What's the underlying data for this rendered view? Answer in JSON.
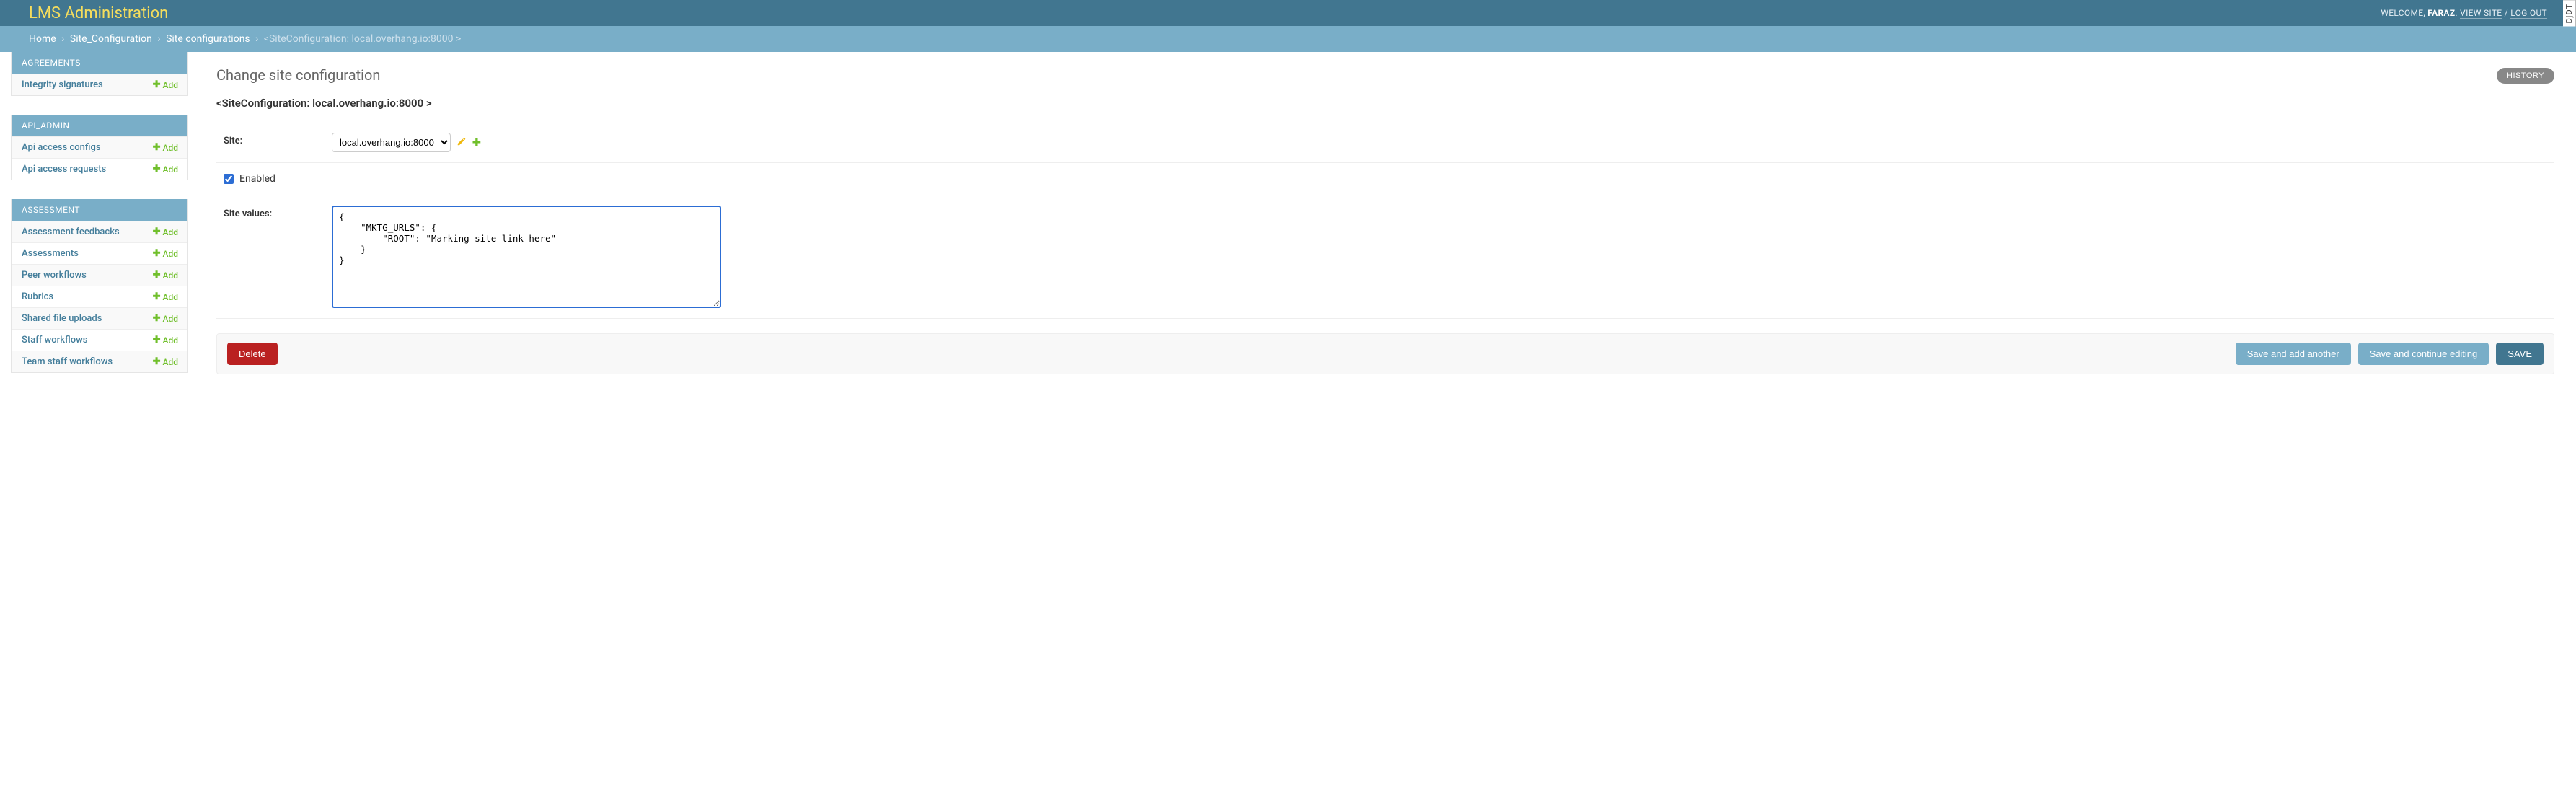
{
  "header": {
    "branding": "LMS Administration",
    "welcome_prefix": "WELCOME, ",
    "username": "FARAZ",
    "view_site": "VIEW SITE",
    "log_out": "LOG OUT",
    "separator": " / "
  },
  "breadcrumbs": {
    "home": "Home",
    "app": "Site_Configuration",
    "model": "Site configurations",
    "current": "<SiteConfiguration: local.overhang.io:8000 >"
  },
  "sidebar": [
    {
      "key": "agreements",
      "caption": "AGREEMENTS",
      "models": [
        {
          "key": "integrity-signatures",
          "name": "Integrity signatures",
          "add": "Add"
        }
      ]
    },
    {
      "key": "api-admin",
      "caption": "API_ADMIN",
      "models": [
        {
          "key": "api-access-configs",
          "name": "Api access configs",
          "add": "Add"
        },
        {
          "key": "api-access-requests",
          "name": "Api access requests",
          "add": "Add"
        }
      ]
    },
    {
      "key": "assessment",
      "caption": "ASSESSMENT",
      "models": [
        {
          "key": "assessment-feedbacks",
          "name": "Assessment feedbacks",
          "add": "Add"
        },
        {
          "key": "assessments",
          "name": "Assessments",
          "add": "Add"
        },
        {
          "key": "peer-workflows",
          "name": "Peer workflows",
          "add": "Add"
        },
        {
          "key": "rubrics",
          "name": "Rubrics",
          "add": "Add"
        },
        {
          "key": "shared-file-uploads",
          "name": "Shared file uploads",
          "add": "Add"
        },
        {
          "key": "staff-workflows",
          "name": "Staff workflows",
          "add": "Add"
        },
        {
          "key": "team-staff-workflows",
          "name": "Team staff workflows",
          "add": "Add"
        }
      ]
    }
  ],
  "main": {
    "title": "Change site configuration",
    "history_label": "HISTORY",
    "object_repr": "<SiteConfiguration: local.overhang.io:8000 >",
    "fields": {
      "site_label": "Site:",
      "site_options": [
        "local.overhang.io:8000"
      ],
      "site_selected": "local.overhang.io:8000",
      "enabled_label": "Enabled",
      "enabled_checked": true,
      "site_values_label": "Site values:",
      "site_values_text": "{\n    \"MKTG_URLS\": {\n        \"ROOT\": \"Marking site link here\"\n    }\n}"
    },
    "buttons": {
      "delete": "Delete",
      "save_add_another": "Save and add another",
      "save_continue": "Save and continue editing",
      "save": "SAVE"
    }
  },
  "djdt": "DjDT"
}
